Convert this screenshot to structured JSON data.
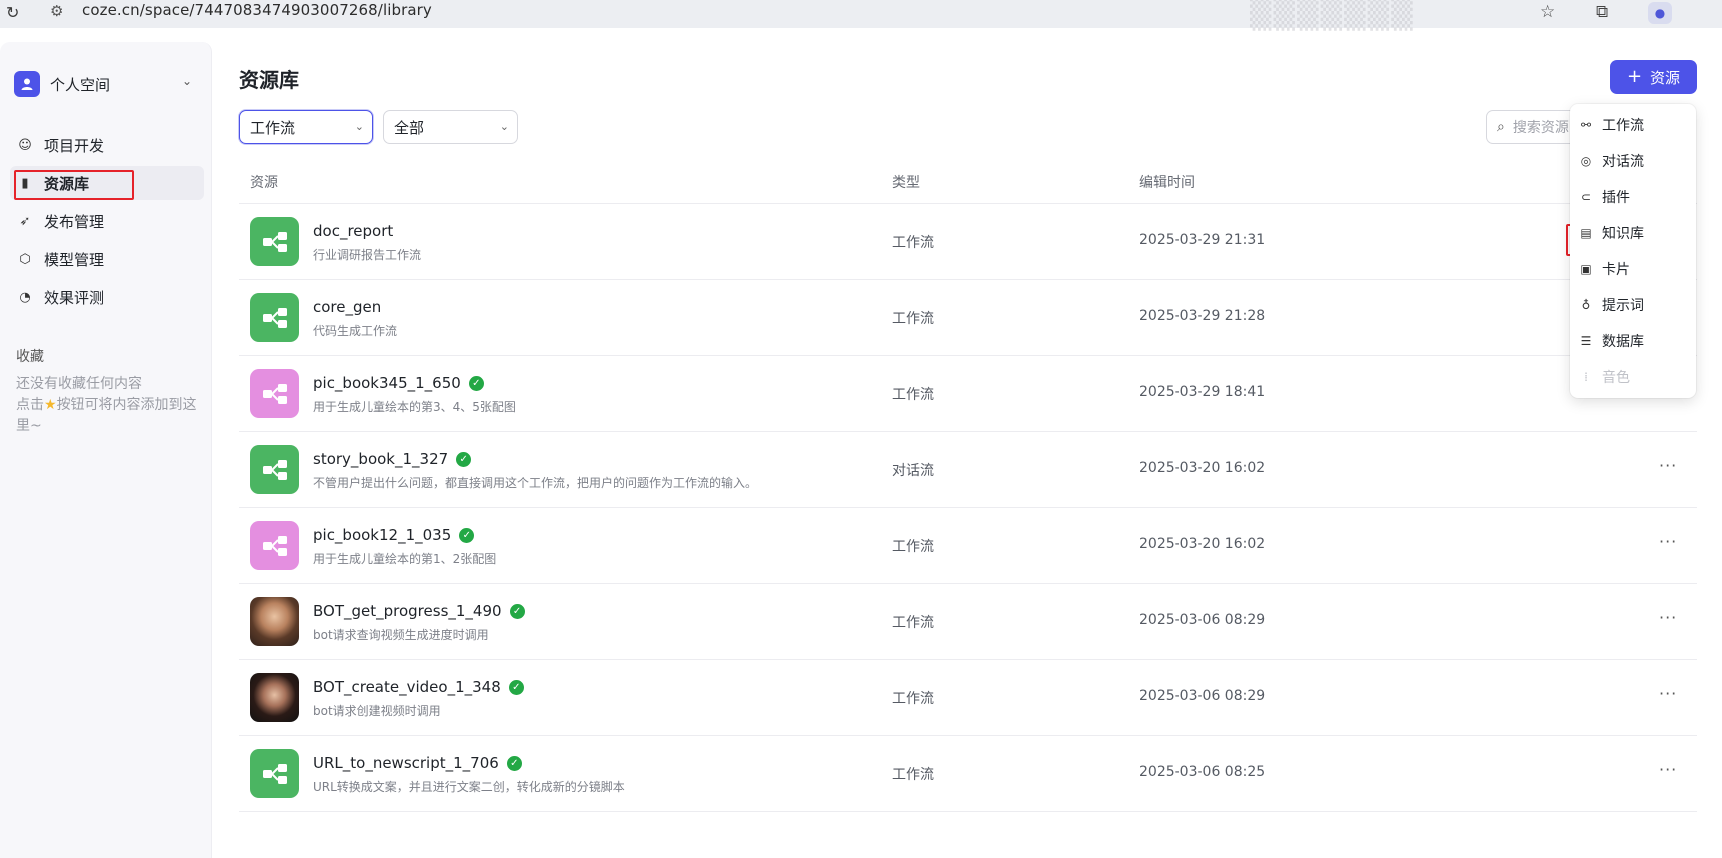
{
  "browser": {
    "url": "coze.cn/space/7447083474903007268/library"
  },
  "sidebar": {
    "space_name": "个人空间",
    "items": [
      {
        "label": "项目开发",
        "icon": "robot-icon"
      },
      {
        "label": "资源库",
        "icon": "library-icon"
      },
      {
        "label": "发布管理",
        "icon": "rocket-icon"
      },
      {
        "label": "模型管理",
        "icon": "cube-icon"
      },
      {
        "label": "效果评测",
        "icon": "gauge-icon"
      }
    ],
    "favorites_title": "收藏",
    "favorites_empty_line1": "还没有收藏任何内容",
    "favorites_empty_line2_before": "点击",
    "favorites_empty_line2_after": "按钮可将内容添加到这里~"
  },
  "main": {
    "title": "资源库",
    "add_button": "资源",
    "filter_type": "工作流",
    "filter_scope": "全部",
    "search_placeholder": "搜索资源"
  },
  "table": {
    "headers": [
      "资源",
      "类型",
      "编辑时间"
    ],
    "rows": [
      {
        "name": "doc_report",
        "desc": "行业调研报告工作流",
        "type": "工作流",
        "time": "2025-03-29 21:31",
        "thumb": "green",
        "verified": false,
        "more": ""
      },
      {
        "name": "core_gen",
        "desc": "代码生成工作流",
        "type": "工作流",
        "time": "2025-03-29 21:28",
        "thumb": "green",
        "verified": false,
        "more": ""
      },
      {
        "name": "pic_book345_1_650",
        "desc": "用于生成儿童绘本的第3、4、5张配图",
        "type": "工作流",
        "time": "2025-03-29 18:41",
        "thumb": "pink",
        "verified": true,
        "more": ""
      },
      {
        "name": "story_book_1_327",
        "desc": "不管用户提出什么问题，都直接调用这个工作流，把用户的问题作为工作流的输入。",
        "type": "对话流",
        "time": "2025-03-20 16:02",
        "thumb": "green",
        "verified": true,
        "more": "···"
      },
      {
        "name": "pic_book12_1_035",
        "desc": "用于生成儿童绘本的第1、2张配图",
        "type": "工作流",
        "time": "2025-03-20 16:02",
        "thumb": "pink",
        "verified": true,
        "more": "···"
      },
      {
        "name": "BOT_get_progress_1_490",
        "desc": "bot请求查询视频生成进度时调用",
        "type": "工作流",
        "time": "2025-03-06 08:29",
        "thumb": "face1",
        "verified": true,
        "more": "···"
      },
      {
        "name": "BOT_create_video_1_348",
        "desc": "bot请求创建视频时调用",
        "type": "工作流",
        "time": "2025-03-06 08:29",
        "thumb": "face2",
        "verified": true,
        "more": "···"
      },
      {
        "name": "URL_to_newscript_1_706",
        "desc": "URL转换成文案，并且进行文案二创，转化成新的分镜脚本",
        "type": "工作流",
        "time": "2025-03-06 08:25",
        "thumb": "green",
        "verified": true,
        "more": "···"
      }
    ]
  },
  "dropdown": {
    "items": [
      {
        "label": "工作流",
        "icon": "workflow-icon",
        "disabled": false
      },
      {
        "label": "对话流",
        "icon": "chatflow-icon",
        "disabled": false
      },
      {
        "label": "插件",
        "icon": "plugin-icon",
        "disabled": false
      },
      {
        "label": "知识库",
        "icon": "knowledge-icon",
        "disabled": false
      },
      {
        "label": "卡片",
        "icon": "card-icon",
        "disabled": false
      },
      {
        "label": "提示词",
        "icon": "bulb-icon",
        "disabled": false
      },
      {
        "label": "数据库",
        "icon": "database-icon",
        "disabled": false
      },
      {
        "label": "音色",
        "icon": "voice-icon",
        "disabled": true
      }
    ]
  },
  "colors": {
    "accent": "#4d53e8",
    "highlight_box": "#e5222a",
    "workflow_thumb": "#4bb562",
    "image_thumb": "#e48fe0",
    "verified": "#23a845"
  }
}
